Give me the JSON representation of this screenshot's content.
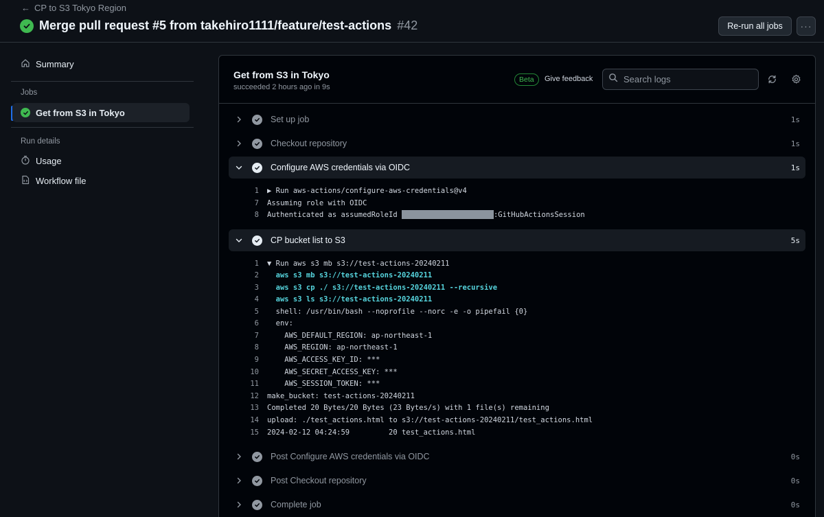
{
  "header": {
    "back_label": "CP to S3 Tokyo Region",
    "title": "Merge pull request #5 from takehiro1111/feature/test-actions",
    "run_number": "#42",
    "rerun_label": "Re-run all jobs",
    "more_label": "···"
  },
  "sidebar": {
    "summary": "Summary",
    "jobs_heading": "Jobs",
    "job": "Get from S3 in Tokyo",
    "details_heading": "Run details",
    "usage": "Usage",
    "workflow_file": "Workflow file"
  },
  "panel": {
    "job_title": "Get from S3 in Tokyo",
    "job_status": "succeeded 2 hours ago in 9s",
    "beta": "Beta",
    "feedback": "Give feedback",
    "search_placeholder": "Search logs"
  },
  "steps": [
    {
      "name": "Set up job",
      "time": "1s"
    },
    {
      "name": "Checkout repository",
      "time": "1s"
    },
    {
      "name": "Configure AWS credentials via OIDC",
      "time": "1s"
    },
    {
      "name": "CP bucket list to S3",
      "time": "5s"
    },
    {
      "name": "Post Configure AWS credentials via OIDC",
      "time": "0s"
    },
    {
      "name": "Post Checkout repository",
      "time": "0s"
    },
    {
      "name": "Complete job",
      "time": "0s"
    }
  ],
  "log_oidc": [
    {
      "n": "1",
      "t": "▶ Run aws-actions/configure-aws-credentials@v4"
    },
    {
      "n": "7",
      "t": "Assuming role with OIDC"
    },
    {
      "n": "8",
      "t": "Authenticated as assumedRoleId ",
      "t2": ":GitHubActionsSession"
    }
  ],
  "log_cp": [
    {
      "n": "1",
      "t": "▼ Run aws s3 mb s3://test-actions-20240211"
    },
    {
      "n": "2",
      "t": "  aws s3 mb s3://test-actions-20240211"
    },
    {
      "n": "3",
      "t": "  aws s3 cp ./ s3://test-actions-20240211 --recursive"
    },
    {
      "n": "4",
      "t": "  aws s3 ls s3://test-actions-20240211"
    },
    {
      "n": "5",
      "t": "  shell: /usr/bin/bash --noprofile --norc -e -o pipefail {0}"
    },
    {
      "n": "6",
      "t": "  env:"
    },
    {
      "n": "7",
      "t": "    AWS_DEFAULT_REGION: ap-northeast-1"
    },
    {
      "n": "8",
      "t": "    AWS_REGION: ap-northeast-1"
    },
    {
      "n": "9",
      "t": "    AWS_ACCESS_KEY_ID: ***"
    },
    {
      "n": "10",
      "t": "    AWS_SECRET_ACCESS_KEY: ***"
    },
    {
      "n": "11",
      "t": "    AWS_SESSION_TOKEN: ***"
    },
    {
      "n": "12",
      "t": "make_bucket: test-actions-20240211"
    },
    {
      "n": "13",
      "t": "Completed 20 Bytes/20 Bytes (23 Bytes/s) with 1 file(s) remaining"
    },
    {
      "n": "14",
      "t": "upload: ./test_actions.html to s3://test-actions-20240211/test_actions.html"
    },
    {
      "n": "15",
      "t": "2024-02-12 04:24:59         20 test_actions.html"
    }
  ]
}
